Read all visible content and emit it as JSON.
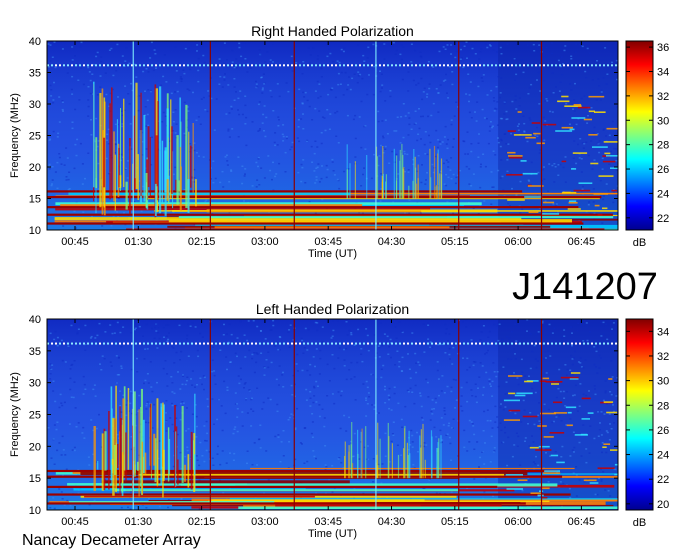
{
  "chart_data": [
    {
      "type": "heatmap",
      "title": "Right Handed Polarization",
      "xlabel": "Time (UT)",
      "ylabel": "Frequency (MHz)",
      "x_ticks": [
        "00:45",
        "01:30",
        "02:15",
        "03:00",
        "03:45",
        "04:30",
        "05:15",
        "06:00",
        "06:45"
      ],
      "y_ticks": [
        10,
        15,
        20,
        25,
        30,
        35,
        40
      ],
      "ylim": [
        10,
        40
      ],
      "colorbar": {
        "ticks": [
          22,
          24,
          26,
          28,
          30,
          32,
          34,
          36
        ],
        "range": [
          21,
          36.5
        ],
        "label": "dB"
      }
    },
    {
      "type": "heatmap",
      "title": "Left Handed Polarization",
      "xlabel": "Time (UT)",
      "ylabel": "Frequency (MHz)",
      "x_ticks": [
        "00:45",
        "01:30",
        "02:15",
        "03:00",
        "03:45",
        "04:30",
        "05:15",
        "06:00",
        "06:45"
      ],
      "y_ticks": [
        10,
        15,
        20,
        25,
        30,
        35,
        40
      ],
      "ylim": [
        10,
        40
      ],
      "colorbar": {
        "ticks": [
          20,
          22,
          24,
          26,
          28,
          30,
          32,
          34
        ],
        "range": [
          19.5,
          35
        ],
        "label": "dB"
      }
    }
  ],
  "event_id": "J141207",
  "footer": "Nancay Decameter Array"
}
